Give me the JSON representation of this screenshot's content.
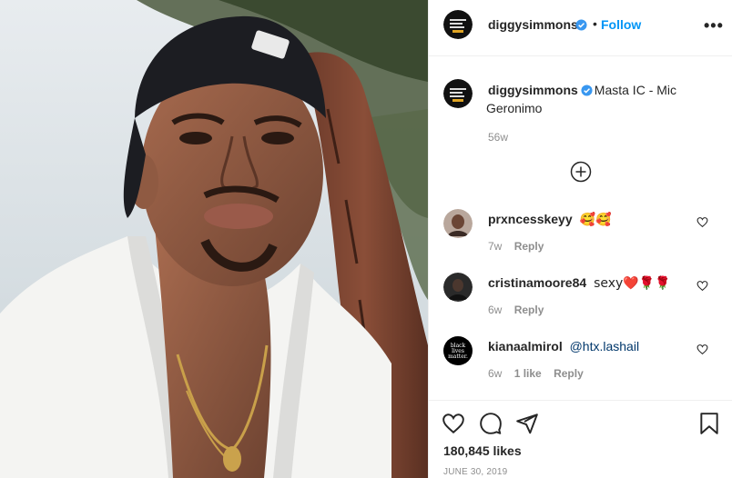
{
  "post": {
    "username": "diggysimmons",
    "follow_label": "Follow",
    "dot": "•",
    "more_label": "•••",
    "caption_text": "Masta IC - Mic Geronimo",
    "caption_time": "56w",
    "likes": "180,845 likes",
    "date": "JUNE 30, 2019"
  },
  "comments": [
    {
      "username": "prxncesskeyy",
      "text": "🥰🥰",
      "time": "7w",
      "likes": "",
      "reply": "Reply"
    },
    {
      "username": "cristinamoore84",
      "text": "sexy❤️🌹🌹",
      "time": "6w",
      "likes": "",
      "reply": "Reply"
    },
    {
      "username": "kianaalmirol",
      "text": "@htx.lashail",
      "time": "6w",
      "likes": "1 like",
      "reply": "Reply"
    }
  ],
  "avatars": {
    "third_comment_lines": [
      "black",
      "lives",
      "matter."
    ]
  },
  "icons": {
    "post_avatar": "profile-avatar-icon",
    "verified": "verified-badge-icon",
    "load_more": "plus-circle-icon",
    "comment_like": "heart-outline-icon",
    "like": "heart-outline-icon",
    "comment": "comment-bubble-icon",
    "share": "paper-plane-icon",
    "save": "bookmark-icon"
  },
  "colors": {
    "accent": "#0095f6",
    "verified": "#3897f0",
    "text": "#262626",
    "muted": "#8e8e8e",
    "mention": "#00376b",
    "border": "#efefef"
  }
}
